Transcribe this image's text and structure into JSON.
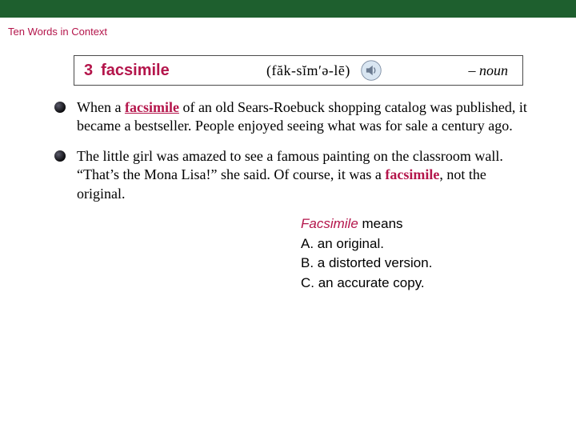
{
  "header": {
    "section_title": "Ten Words in Context"
  },
  "word_box": {
    "number": "3",
    "term": "facsimile",
    "pronunciation": "(făk-sĭmʹə-lē)",
    "part_of_speech": "– noun"
  },
  "examples": [
    {
      "pre": "When a ",
      "hl": "facsimile",
      "post": " of an old Sears-Roebuck shopping catalog was published, it became a bestseller. People enjoyed seeing what was for sale a century ago.",
      "underline": true
    },
    {
      "pre": "The little girl was amazed to see a famous painting on the classroom wall. “That’s the Mona Lisa!” she said. Of course, it was a ",
      "hl": "facsimile",
      "post": ", not the original.",
      "underline": false
    }
  ],
  "question": {
    "term": "Facsimile",
    "prompt": " means",
    "options": {
      "A": "A. an original.",
      "B": "B. a distorted version.",
      "C": "C. an accurate copy."
    }
  }
}
